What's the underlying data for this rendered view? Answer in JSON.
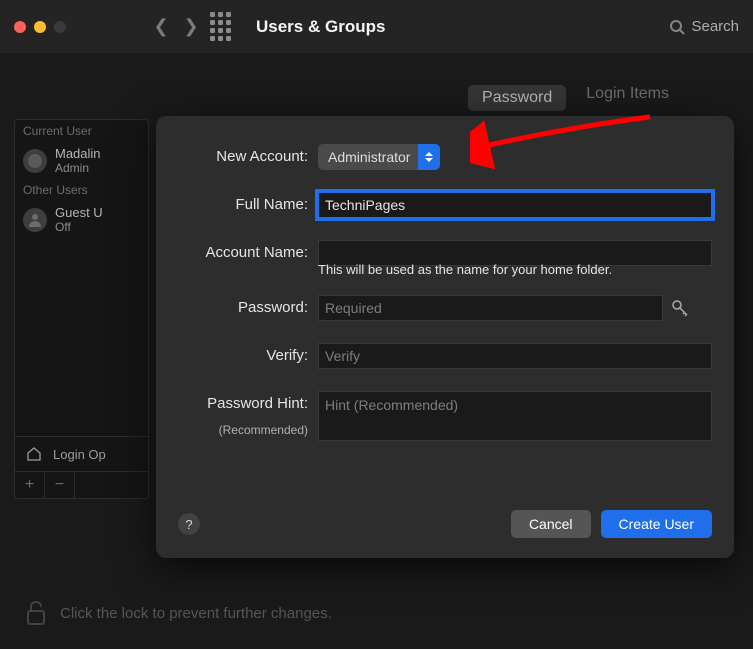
{
  "titlebar": {
    "title": "Users & Groups",
    "search_placeholder": "Search"
  },
  "bg": {
    "tabs": {
      "password": "Password",
      "login_items": "Login Items"
    },
    "sidebar": {
      "current_header": "Current User",
      "current_user": {
        "name": "Madalin",
        "role": "Admin"
      },
      "other_header": "Other Users",
      "guest": {
        "name": "Guest U",
        "status": "Off"
      },
      "login_options": "Login Op"
    },
    "lock_text": "Click the lock to prevent further changes."
  },
  "sheet": {
    "labels": {
      "new_account": "New Account:",
      "full_name": "Full Name:",
      "account_name": "Account Name:",
      "password": "Password:",
      "verify": "Verify:",
      "hint": "Password Hint:",
      "hint_sub": "(Recommended)"
    },
    "values": {
      "account_type": "Administrator",
      "full_name": "TechniPages",
      "account_name": "",
      "password": "",
      "verify": "",
      "hint": ""
    },
    "placeholders": {
      "password": "Required",
      "verify": "Verify",
      "hint": "Hint (Recommended)"
    },
    "hint_help": "This will be used as the name for your home folder.",
    "buttons": {
      "help": "?",
      "cancel": "Cancel",
      "create": "Create User"
    }
  }
}
